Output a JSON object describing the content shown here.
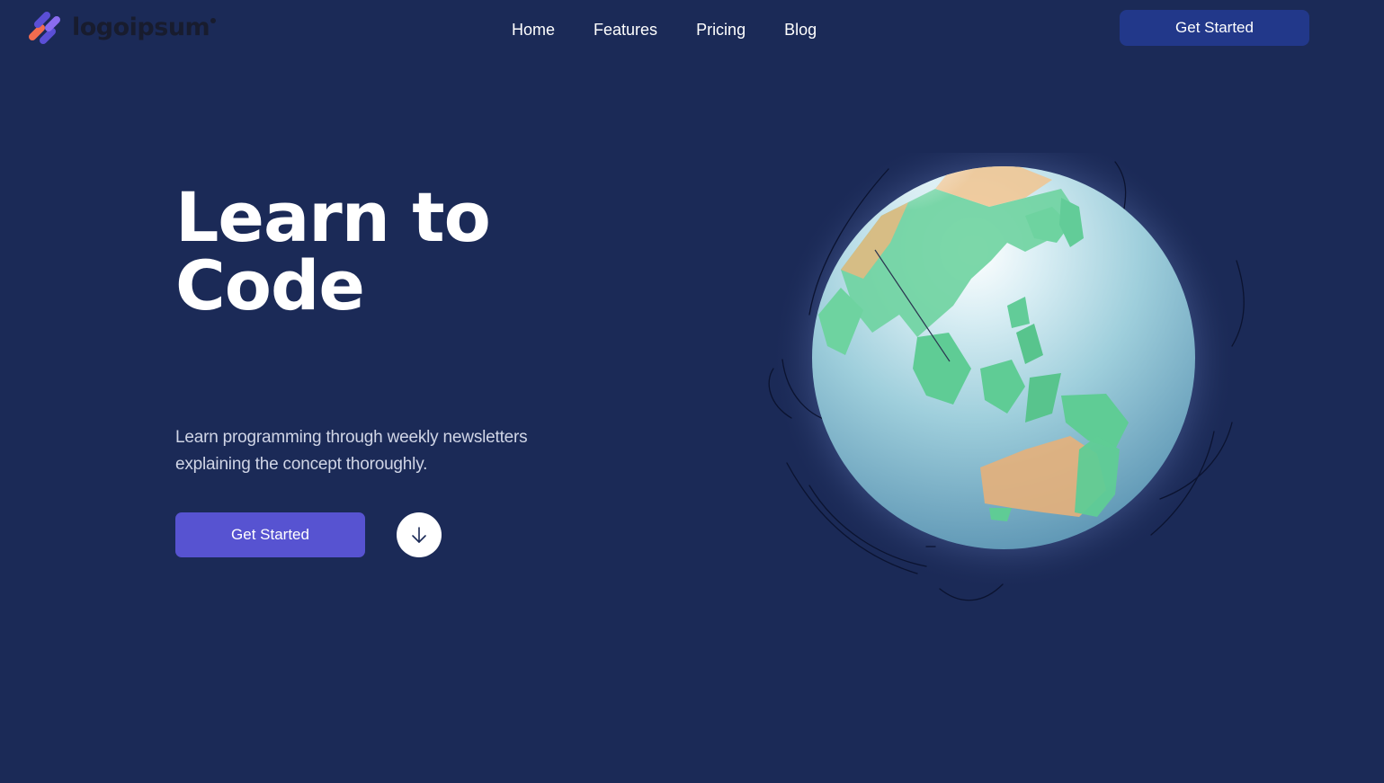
{
  "header": {
    "logo": {
      "text": "logoipsum",
      "icon": "logo-mark-icon",
      "colors": [
        "#f26c4f",
        "#5b4fd6",
        "#8a6cf0"
      ]
    },
    "nav": [
      {
        "label": "Home"
      },
      {
        "label": "Features"
      },
      {
        "label": "Pricing"
      },
      {
        "label": "Blog"
      }
    ],
    "cta_label": "Get Started"
  },
  "hero": {
    "title_line1": "Learn to",
    "title_line2": "Code",
    "subtitle": "Learn programming through weekly newsletters explaining the concept thoroughly.",
    "cta_label": "Get Started",
    "scroll_icon": "arrow-down-icon"
  },
  "visual": {
    "globe_icon": "globe-illustration"
  },
  "colors": {
    "background": "#1b2a57",
    "header_button": "#22388a",
    "primary_button": "#5753d1",
    "text_primary": "#ffffff",
    "text_muted": "#d0d5e6"
  }
}
